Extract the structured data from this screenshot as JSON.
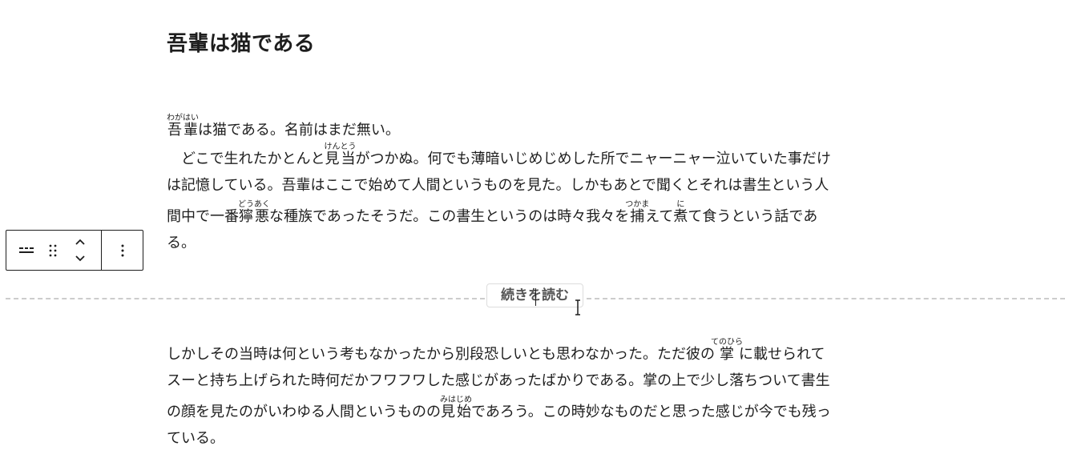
{
  "post": {
    "title": "吾輩は猫である"
  },
  "paragraph1": {
    "lines": [
      [
        {
          "ruby": "吾輩",
          "rt": "わがはい"
        },
        {
          "t": "は猫である。名前はまだ無い。"
        }
      ],
      [
        {
          "t": "　どこで生れたかとんと"
        },
        {
          "ruby": "見当",
          "rt": "けんとう"
        },
        {
          "t": "がつかぬ。何でも薄暗いじめじめした所でニャーニャー泣いていた事だけ"
        }
      ],
      [
        {
          "t": "は記憶している。吾輩はここで始めて人間というものを見た。しかもあとで聞くとそれは書生という人"
        }
      ],
      [
        {
          "t": "間中で一番"
        },
        {
          "ruby": "獰悪",
          "rt": "どうあく"
        },
        {
          "t": "な種族であったそうだ。この書生というのは時々我々を"
        },
        {
          "ruby": "捕",
          "rt": "つかま"
        },
        {
          "t": "えて"
        },
        {
          "ruby": "煮",
          "rt": "に"
        },
        {
          "t": "て食うという話であ"
        }
      ],
      [
        {
          "t": "る。"
        }
      ]
    ]
  },
  "more_block": {
    "label": "続きを読む"
  },
  "paragraph2": {
    "lines": [
      [
        {
          "t": "しかしその当時は何という考もなかったから別段恐しいとも思わなかった。ただ彼の"
        },
        {
          "ruby": "掌",
          "rt": "てのひら"
        },
        {
          "t": "に載せられて"
        }
      ],
      [
        {
          "t": "スーと持ち上げられた時何だかフワフワした感じがあったばかりである。掌の上で少し落ちついて書生"
        }
      ],
      [
        {
          "t": "の顔を見たのがいわゆる人間というものの"
        },
        {
          "ruby": "見始",
          "rt": "みはじめ"
        },
        {
          "t": "であろう。この時妙なものだと思った感じが今でも残っ"
        }
      ],
      [
        {
          "t": "ている。"
        }
      ]
    ]
  },
  "toolbar": {
    "block_type_icon": "more-block-icon",
    "drag_icon": "drag-handle-icon",
    "move_up_icon": "chevron-up-icon",
    "move_down_icon": "chevron-down-icon",
    "options_icon": "more-vertical-icon"
  },
  "colors": {
    "text": "#1e1e1e",
    "dashed_line": "#cccccc",
    "more_label_text": "#555555"
  }
}
